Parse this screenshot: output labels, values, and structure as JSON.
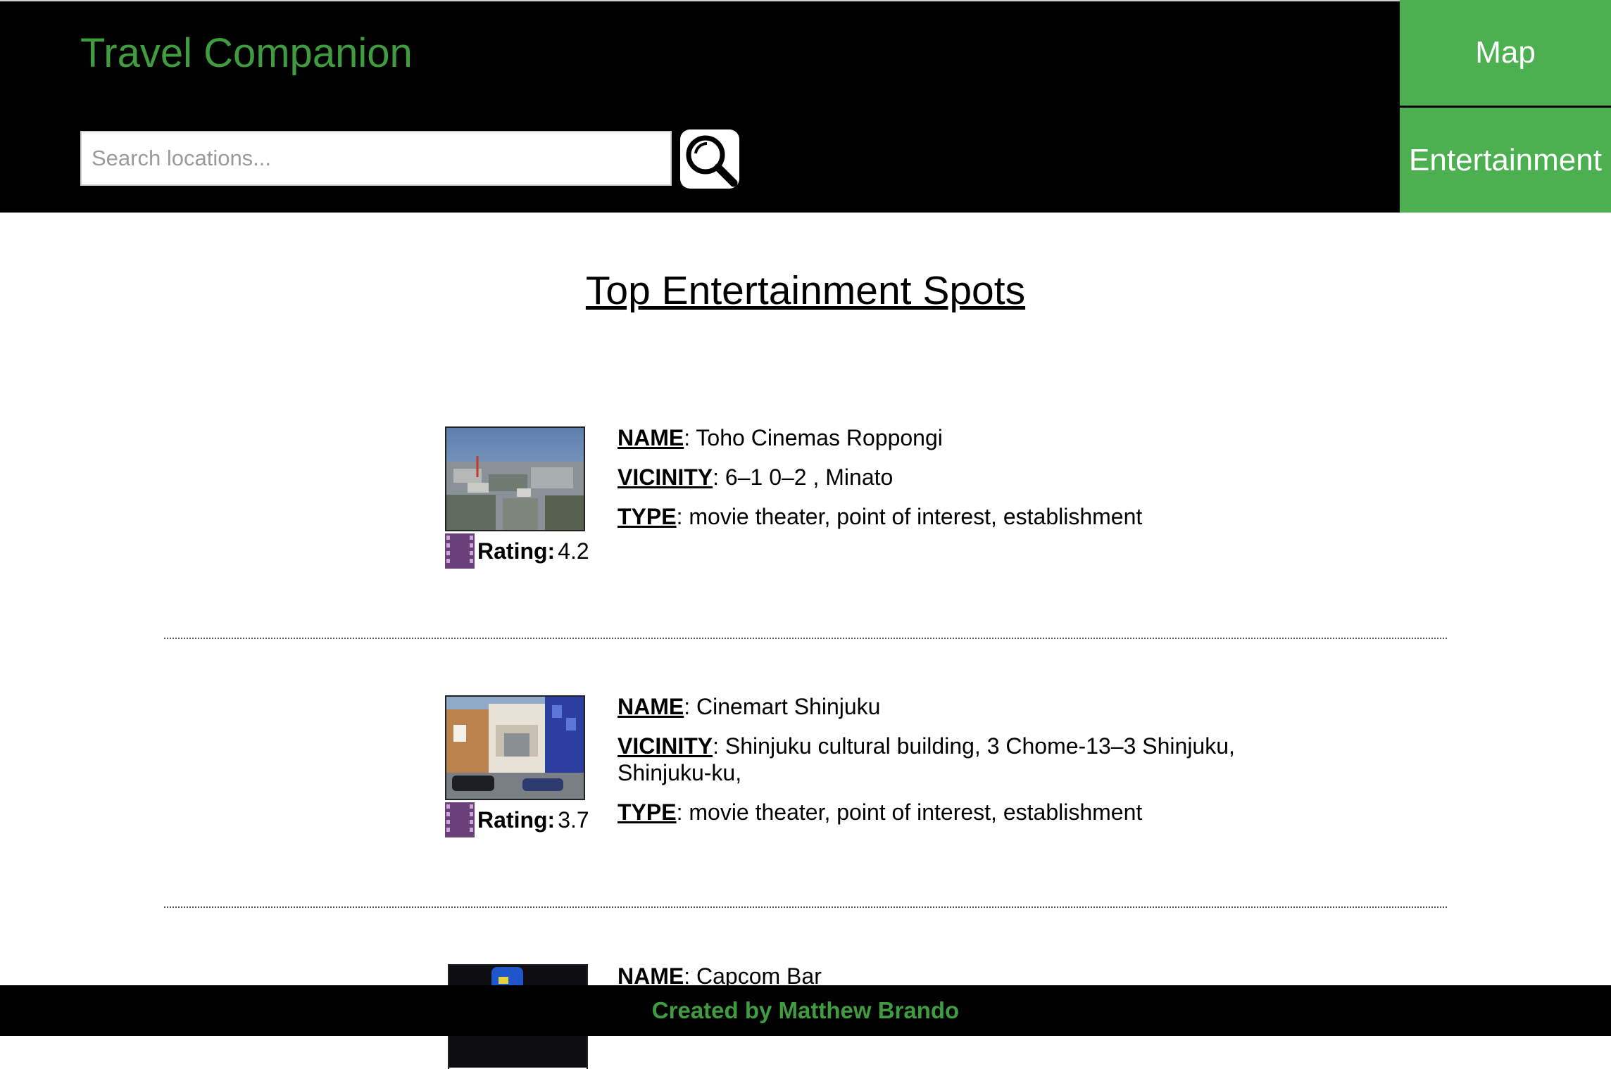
{
  "header": {
    "app_title": "Travel Companion",
    "search_placeholder": "Search locations...",
    "search_value": "",
    "nav": {
      "map_label": "Map",
      "entertainment_label": "Entertainment"
    },
    "accent_color": "#4caf50"
  },
  "main": {
    "title": "Top Entertainment Spots",
    "keys": {
      "name": "NAME",
      "vicinity": "VICINITY",
      "type": "TYPE",
      "rating": "Rating:"
    },
    "entries": [
      {
        "name": "Toho Cinemas Roppongi",
        "vicinity": " 6–1 0–2 , Minato",
        "type": "movie theater, point of interest, establishment",
        "rating": "4.2",
        "thumbnail": "city-skyline-photo"
      },
      {
        "name": "Cinemart Shinjuku",
        "vicinity": "Shinjuku cultural building, 3 Chome-13–3 Shinjuku, Shinjuku-ku,",
        "type": "movie theater, point of interest, establishment",
        "rating": "3.7",
        "thumbnail": "street-building-photo"
      },
      {
        "name": "Capcom Bar",
        "thumbnail": "dark-game-photo"
      }
    ]
  },
  "footer": {
    "credit": "Created by Matthew Brando"
  },
  "icons": {
    "search": "magnifier-icon",
    "rating": "film-strip-icon"
  }
}
